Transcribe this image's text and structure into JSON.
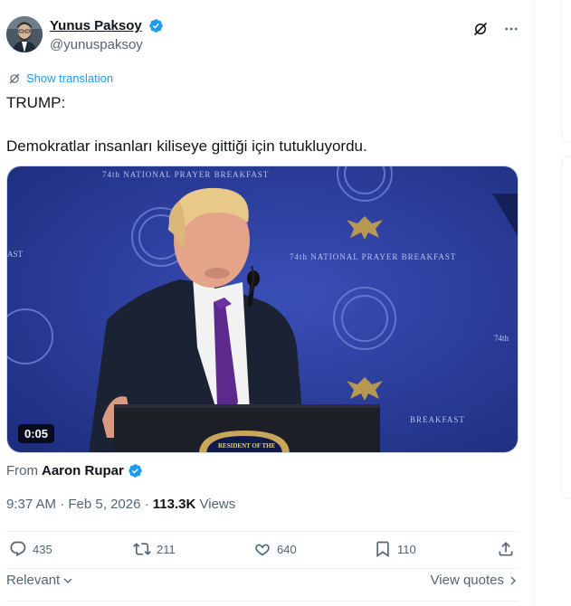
{
  "author": {
    "display_name": "Yunus Paksoy",
    "handle": "@yunuspaksoy",
    "verified": true
  },
  "header_icons": [
    "grok-icon",
    "more-icon"
  ],
  "translation": {
    "label": "Show translation"
  },
  "tweet": {
    "lines": [
      "TRUMP:",
      "Demokratlar insanları kiliseye gittiği için tutukluyordu."
    ]
  },
  "media": {
    "duration": "0:05",
    "backdrop_text": [
      "74th NATIONAL PRAYER BREAKFAST",
      "74th NATIONAL PRAYER BREAKFAST",
      "BREAKFAST",
      "AST",
      "74th",
      "RESIDENT OF THE"
    ]
  },
  "source": {
    "prefix": "From",
    "name": "Aaron Rupar",
    "verified": true
  },
  "meta": {
    "time": "9:37 AM",
    "separator": "·",
    "date": "Feb 5, 2026",
    "views_count": "113.3K",
    "views_label": "Views"
  },
  "actions": {
    "replies": "435",
    "reposts": "211",
    "likes": "640",
    "bookmarks": "110"
  },
  "footer": {
    "sort_label": "Relevant",
    "quotes_label": "View quotes"
  },
  "colors": {
    "accent": "#1d9bf0",
    "text": "#0f1419",
    "secondary": "#536471",
    "border": "#eff3f4",
    "video_backdrop": "#2c3e9a"
  }
}
